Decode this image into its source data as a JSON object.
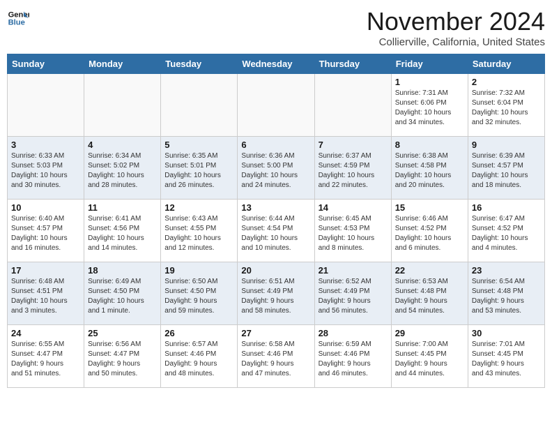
{
  "header": {
    "logo_line1": "General",
    "logo_line2": "Blue",
    "month": "November 2024",
    "location": "Collierville, California, United States"
  },
  "weekdays": [
    "Sunday",
    "Monday",
    "Tuesday",
    "Wednesday",
    "Thursday",
    "Friday",
    "Saturday"
  ],
  "weeks": [
    [
      {
        "day": "",
        "info": ""
      },
      {
        "day": "",
        "info": ""
      },
      {
        "day": "",
        "info": ""
      },
      {
        "day": "",
        "info": ""
      },
      {
        "day": "",
        "info": ""
      },
      {
        "day": "1",
        "info": "Sunrise: 7:31 AM\nSunset: 6:06 PM\nDaylight: 10 hours\nand 34 minutes."
      },
      {
        "day": "2",
        "info": "Sunrise: 7:32 AM\nSunset: 6:04 PM\nDaylight: 10 hours\nand 32 minutes."
      }
    ],
    [
      {
        "day": "3",
        "info": "Sunrise: 6:33 AM\nSunset: 5:03 PM\nDaylight: 10 hours\nand 30 minutes."
      },
      {
        "day": "4",
        "info": "Sunrise: 6:34 AM\nSunset: 5:02 PM\nDaylight: 10 hours\nand 28 minutes."
      },
      {
        "day": "5",
        "info": "Sunrise: 6:35 AM\nSunset: 5:01 PM\nDaylight: 10 hours\nand 26 minutes."
      },
      {
        "day": "6",
        "info": "Sunrise: 6:36 AM\nSunset: 5:00 PM\nDaylight: 10 hours\nand 24 minutes."
      },
      {
        "day": "7",
        "info": "Sunrise: 6:37 AM\nSunset: 4:59 PM\nDaylight: 10 hours\nand 22 minutes."
      },
      {
        "day": "8",
        "info": "Sunrise: 6:38 AM\nSunset: 4:58 PM\nDaylight: 10 hours\nand 20 minutes."
      },
      {
        "day": "9",
        "info": "Sunrise: 6:39 AM\nSunset: 4:57 PM\nDaylight: 10 hours\nand 18 minutes."
      }
    ],
    [
      {
        "day": "10",
        "info": "Sunrise: 6:40 AM\nSunset: 4:57 PM\nDaylight: 10 hours\nand 16 minutes."
      },
      {
        "day": "11",
        "info": "Sunrise: 6:41 AM\nSunset: 4:56 PM\nDaylight: 10 hours\nand 14 minutes."
      },
      {
        "day": "12",
        "info": "Sunrise: 6:43 AM\nSunset: 4:55 PM\nDaylight: 10 hours\nand 12 minutes."
      },
      {
        "day": "13",
        "info": "Sunrise: 6:44 AM\nSunset: 4:54 PM\nDaylight: 10 hours\nand 10 minutes."
      },
      {
        "day": "14",
        "info": "Sunrise: 6:45 AM\nSunset: 4:53 PM\nDaylight: 10 hours\nand 8 minutes."
      },
      {
        "day": "15",
        "info": "Sunrise: 6:46 AM\nSunset: 4:52 PM\nDaylight: 10 hours\nand 6 minutes."
      },
      {
        "day": "16",
        "info": "Sunrise: 6:47 AM\nSunset: 4:52 PM\nDaylight: 10 hours\nand 4 minutes."
      }
    ],
    [
      {
        "day": "17",
        "info": "Sunrise: 6:48 AM\nSunset: 4:51 PM\nDaylight: 10 hours\nand 3 minutes."
      },
      {
        "day": "18",
        "info": "Sunrise: 6:49 AM\nSunset: 4:50 PM\nDaylight: 10 hours\nand 1 minute."
      },
      {
        "day": "19",
        "info": "Sunrise: 6:50 AM\nSunset: 4:50 PM\nDaylight: 9 hours\nand 59 minutes."
      },
      {
        "day": "20",
        "info": "Sunrise: 6:51 AM\nSunset: 4:49 PM\nDaylight: 9 hours\nand 58 minutes."
      },
      {
        "day": "21",
        "info": "Sunrise: 6:52 AM\nSunset: 4:49 PM\nDaylight: 9 hours\nand 56 minutes."
      },
      {
        "day": "22",
        "info": "Sunrise: 6:53 AM\nSunset: 4:48 PM\nDaylight: 9 hours\nand 54 minutes."
      },
      {
        "day": "23",
        "info": "Sunrise: 6:54 AM\nSunset: 4:48 PM\nDaylight: 9 hours\nand 53 minutes."
      }
    ],
    [
      {
        "day": "24",
        "info": "Sunrise: 6:55 AM\nSunset: 4:47 PM\nDaylight: 9 hours\nand 51 minutes."
      },
      {
        "day": "25",
        "info": "Sunrise: 6:56 AM\nSunset: 4:47 PM\nDaylight: 9 hours\nand 50 minutes."
      },
      {
        "day": "26",
        "info": "Sunrise: 6:57 AM\nSunset: 4:46 PM\nDaylight: 9 hours\nand 48 minutes."
      },
      {
        "day": "27",
        "info": "Sunrise: 6:58 AM\nSunset: 4:46 PM\nDaylight: 9 hours\nand 47 minutes."
      },
      {
        "day": "28",
        "info": "Sunrise: 6:59 AM\nSunset: 4:46 PM\nDaylight: 9 hours\nand 46 minutes."
      },
      {
        "day": "29",
        "info": "Sunrise: 7:00 AM\nSunset: 4:45 PM\nDaylight: 9 hours\nand 44 minutes."
      },
      {
        "day": "30",
        "info": "Sunrise: 7:01 AM\nSunset: 4:45 PM\nDaylight: 9 hours\nand 43 minutes."
      }
    ]
  ],
  "alt_rows": [
    1,
    3
  ],
  "colors": {
    "header_bg": "#2e6da4",
    "alt_row_bg": "#e8eef5",
    "empty_bg": "#f5f5f5"
  }
}
